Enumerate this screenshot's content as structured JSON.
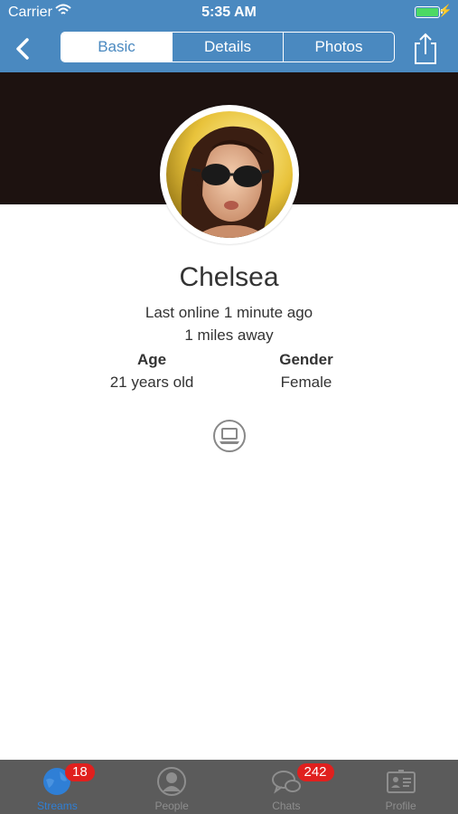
{
  "status_bar": {
    "carrier": "Carrier",
    "time": "5:35 AM",
    "wifi_icon": "wifi-icon",
    "battery_icon": "battery-full-charging-icon"
  },
  "nav": {
    "back_icon": "chevron-left-icon",
    "tabs": [
      {
        "label": "Basic",
        "active": true
      },
      {
        "label": "Details",
        "active": false
      },
      {
        "label": "Photos",
        "active": false
      }
    ],
    "share_icon": "share-icon",
    "color": "#4a89c0"
  },
  "profile": {
    "name": "Chelsea",
    "last_online": "Last online 1 minute ago",
    "distance": "1 miles away",
    "age_label": "Age",
    "age_value": "21 years old",
    "gender_label": "Gender",
    "gender_value": "Female",
    "device_icon": "laptop-icon"
  },
  "tabbar": {
    "items": [
      {
        "label": "Streams",
        "icon": "globe-icon",
        "badge": "18",
        "active": true
      },
      {
        "label": "People",
        "icon": "person-icon",
        "badge": "",
        "active": false
      },
      {
        "label": "Chats",
        "icon": "chat-bubbles-icon",
        "badge": "242",
        "active": false
      },
      {
        "label": "Profile",
        "icon": "id-card-icon",
        "badge": "",
        "active": false
      }
    ],
    "accent_color": "#2f7fd6",
    "badge_color": "#e0201e"
  }
}
